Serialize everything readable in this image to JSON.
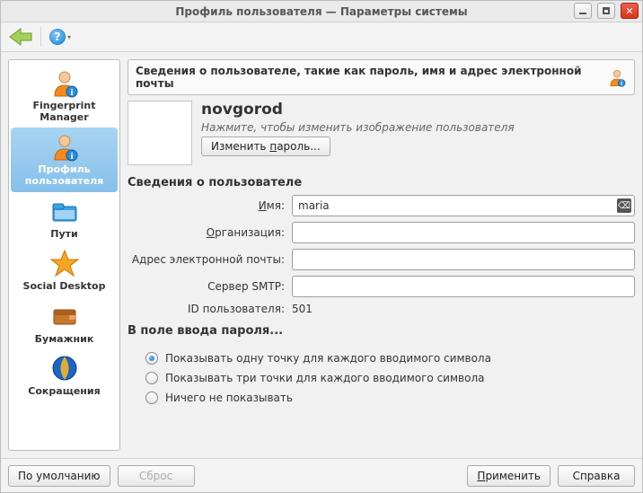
{
  "window": {
    "title": "Профиль пользователя — Параметры системы"
  },
  "sidebar": {
    "items": [
      {
        "label": "Fingerprint Manager"
      },
      {
        "label": "Профиль пользователя"
      },
      {
        "label": "Пути"
      },
      {
        "label": "Social Desktop"
      },
      {
        "label": "Бумажник"
      },
      {
        "label": "Сокращения"
      }
    ],
    "selected_index": 1
  },
  "banner": {
    "text": "Сведения о пользователе, такие как пароль, имя и адрес электронной почты"
  },
  "user": {
    "name": "novgorod",
    "hint": "Нажмите, чтобы изменить изображение пользователя",
    "change_password_label": "Изменить пароль..."
  },
  "section": {
    "details_head": "Сведения о пользователе",
    "password_head": "В поле ввода пароля..."
  },
  "form": {
    "name_label": "Имя:",
    "name_value": "maria",
    "org_label": "Организация:",
    "org_value": "",
    "email_label": "Адрес электронной почты:",
    "email_value": "",
    "smtp_label": "Сервер SMTP:",
    "smtp_value": "",
    "uid_label": "ID пользователя:",
    "uid_value": "501"
  },
  "password_radios": {
    "selected": 0,
    "options": [
      "Показывать одну точку для каждого вводимого символа",
      "Показывать три точки для каждого вводимого символа",
      "Ничего не показывать"
    ]
  },
  "buttons": {
    "defaults": "По умолчанию",
    "reset": "Сброс",
    "apply": "Применить",
    "help": "Справка"
  }
}
